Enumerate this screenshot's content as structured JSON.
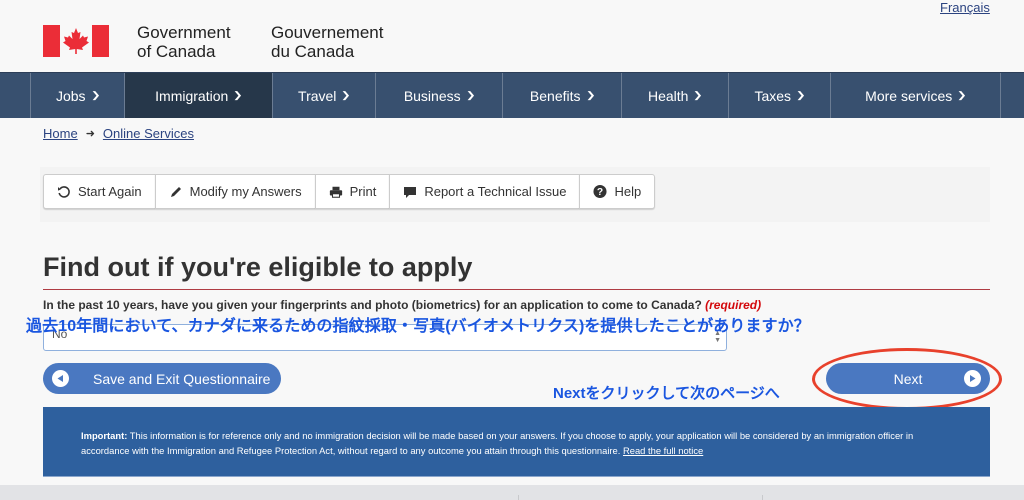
{
  "header": {
    "signature_en": [
      "Government",
      "of Canada"
    ],
    "signature_fr": [
      "Gouvernement",
      "du Canada"
    ],
    "language_link": "Français",
    "flag_colors": {
      "red": "#eb2d37",
      "white": "#ffffff"
    }
  },
  "nav": {
    "items": [
      {
        "label": "Jobs",
        "active": false
      },
      {
        "label": "Immigration",
        "active": true
      },
      {
        "label": "Travel",
        "active": false
      },
      {
        "label": "Business",
        "active": false
      },
      {
        "label": "Benefits",
        "active": false
      },
      {
        "label": "Health",
        "active": false
      },
      {
        "label": "Taxes",
        "active": false
      },
      {
        "label": "More services",
        "active": false
      }
    ],
    "chevron_icon": "chevron-down-icon",
    "bg_color": "#38506f",
    "active_color": "#26374a"
  },
  "breadcrumb": {
    "items": [
      "Home",
      "Online Services"
    ],
    "separator_icon": "arrow-right-icon"
  },
  "toolbar": {
    "buttons": [
      {
        "label": "Start Again",
        "icon": "refresh-icon"
      },
      {
        "label": "Modify my Answers",
        "icon": "pencil-icon"
      },
      {
        "label": "Print",
        "icon": "printer-icon"
      },
      {
        "label": "Report a Technical Issue",
        "icon": "comment-icon"
      },
      {
        "label": "Help",
        "icon": "question-circle-icon"
      }
    ]
  },
  "main": {
    "title": "Find out if you're eligible to apply",
    "question": "In the past 10 years, have you given your fingerprints and photo (biometrics) for an application to come to Canada?",
    "required_label": "(required)",
    "select_value": "No",
    "save_button": "Save and Exit Questionnaire",
    "next_button": "Next"
  },
  "annotations": {
    "question_translation": "過去10年間において、カナダに来るための指紋採取・写真(バイオメトリクス)を提供したことがありますか？",
    "next_hint": "Nextをクリックして次のページへ",
    "annotation_color": "#1a56e0",
    "highlight_color": "#e8412c"
  },
  "notice": {
    "label": "Important:",
    "text": " This information is for reference only and no immigration decision will be made based on your answers. If you choose to apply, your application will be considered by an immigration officer in accordance with the Immigration and Refugee Protection Act, without regard to any outcome you attain through this questionnaire. ",
    "link": "Read the full notice",
    "bg_color": "#2e609e"
  }
}
